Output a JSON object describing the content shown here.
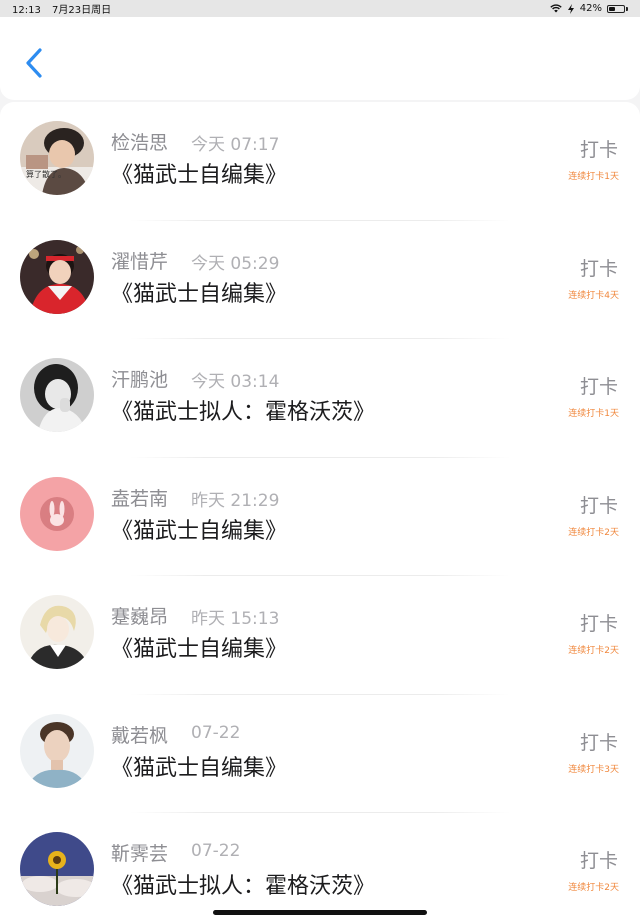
{
  "status_bar": {
    "time": "12:13",
    "date": "7月23日周日",
    "battery": "42%",
    "battery_level": 0.42
  },
  "nav": {
    "back_icon": "chevron-left-icon",
    "accent": "#2d8cf0"
  },
  "checkin_label": "打卡",
  "entries": [
    {
      "name": "检浩思",
      "time": "今天 07:17",
      "title": "《猫武士自编集》",
      "streak": "连续打卡1天",
      "avatar_text": "算了散了。"
    },
    {
      "name": "濯惜芹",
      "time": "今天 05:29",
      "title": "《猫武士自编集》",
      "streak": "连续打卡4天"
    },
    {
      "name": "汗鹏池",
      "time": "今天 03:14",
      "title": "《猫武士拟人：霍格沃茨》",
      "streak": "连续打卡1天"
    },
    {
      "name": "盍若南",
      "time": "昨天 21:29",
      "title": "《猫武士自编集》",
      "streak": "连续打卡2天"
    },
    {
      "name": "蹇巍昂",
      "time": "昨天 15:13",
      "title": "《猫武士自编集》",
      "streak": "连续打卡2天"
    },
    {
      "name": "戴若枫",
      "time": "07-22",
      "title": "《猫武士自编集》",
      "streak": "连续打卡3天"
    },
    {
      "name": "靳霁芸",
      "time": "07-22",
      "title": "《猫武士拟人：霍格沃茨》",
      "streak": "连续打卡2天"
    }
  ]
}
